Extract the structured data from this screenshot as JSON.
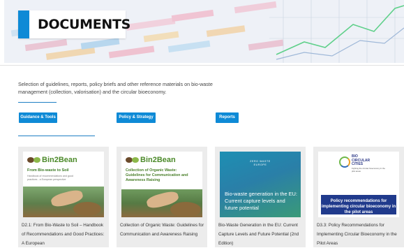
{
  "page": {
    "title": "DOCUMENTS"
  },
  "intro": "Selection of guidelines, reports, policy briefs and other reference materials on bio-waste management (collection, valorisation) and the circular bioeconomy.",
  "filters": [
    "Guidance & Tools",
    "Policy & Strategy",
    "Reports"
  ],
  "cards": [
    {
      "brand": "Bin2Bean",
      "cover_title": "From Bio-waste to Soil",
      "cover_subtitle": "Handbook of recommendations and good practices - a European perspective",
      "caption": "D2.1: From Bio-Waste to Soil – Handbook of Recommendations and Good Practices: A European"
    },
    {
      "brand": "Bin2Bean",
      "cover_title": "Collection of Organic Waste: Guidelines for Communication and Awareness Raising",
      "caption": "Collection of Organic Waste: Guidelines for Communication and Awareness Raising"
    },
    {
      "brand": "ZERO WASTE EUROPE",
      "cover_title": "Bio-waste generation in the EU: Current capture levels and future potential",
      "caption": "Bio-Waste Generation in the EU: Current Capture Levels and Future Potential (2nd Edition)"
    },
    {
      "brand": "BIO CIRCULAR CITIES",
      "brand_tagline": "Fighting the circular bioeconomy in the pilot areas",
      "cover_title": "Policy recommendations for implementing circular bioeconomy in the pilot areas",
      "caption": "D3.3: Policy Recommendations for Implementing Circular Bioeconomy in the Pilot Areas"
    }
  ]
}
